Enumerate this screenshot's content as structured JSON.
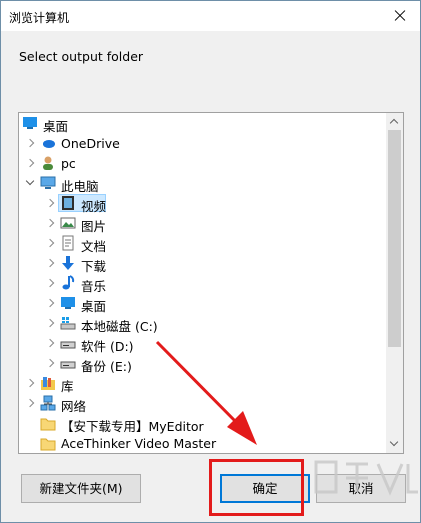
{
  "window": {
    "title": "浏览计算机",
    "prompt": "Select output folder"
  },
  "tree": {
    "items": [
      {
        "label": "桌面",
        "icon": "desktop-icon",
        "level": 0,
        "expander": "none"
      },
      {
        "label": "OneDrive",
        "icon": "cloud-icon",
        "level": 1,
        "expander": "right"
      },
      {
        "label": "pc",
        "icon": "user-icon",
        "level": 1,
        "expander": "right"
      },
      {
        "label": "此电脑",
        "icon": "computer-icon",
        "level": 1,
        "expander": "down"
      },
      {
        "label": "视频",
        "icon": "video-folder-icon",
        "level": 2,
        "expander": "right",
        "selected": true
      },
      {
        "label": "图片",
        "icon": "pictures-folder-icon",
        "level": 2,
        "expander": "right"
      },
      {
        "label": "文档",
        "icon": "documents-folder-icon",
        "level": 2,
        "expander": "right"
      },
      {
        "label": "下载",
        "icon": "download-folder-icon",
        "level": 2,
        "expander": "right"
      },
      {
        "label": "音乐",
        "icon": "music-folder-icon",
        "level": 2,
        "expander": "right"
      },
      {
        "label": "桌面",
        "icon": "desktop-folder-icon",
        "level": 2,
        "expander": "right"
      },
      {
        "label": "本地磁盘 (C:)",
        "icon": "system-drive-icon",
        "level": 2,
        "expander": "right"
      },
      {
        "label": "软件 (D:)",
        "icon": "drive-icon",
        "level": 2,
        "expander": "right"
      },
      {
        "label": "备份 (E:)",
        "icon": "drive-icon",
        "level": 2,
        "expander": "right"
      },
      {
        "label": "库",
        "icon": "library-icon",
        "level": 1,
        "expander": "right"
      },
      {
        "label": "网络",
        "icon": "network-icon",
        "level": 1,
        "expander": "right"
      },
      {
        "label": "【安下载专用】MyEditor",
        "icon": "folder-icon",
        "level": 1,
        "expander": "none"
      },
      {
        "label": "AceThinker Video Master",
        "icon": "folder-icon",
        "level": 1,
        "expander": "none"
      }
    ]
  },
  "buttons": {
    "new_folder": "新建文件夹(M)",
    "ok": "确定",
    "cancel": "取消"
  },
  "colors": {
    "annotation_red": "#e31b1b",
    "selection": "#cce8ff",
    "default_button_border": "#0078d7"
  }
}
